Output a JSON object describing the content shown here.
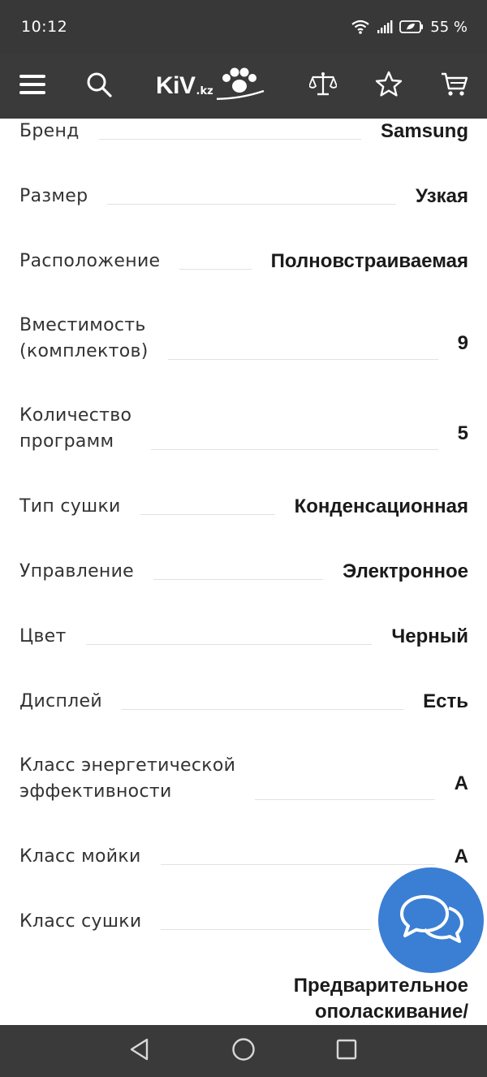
{
  "status_bar": {
    "time": "10:12",
    "battery_text": "55 %",
    "icons": [
      "wifi-icon",
      "signal-icon",
      "battery-saver-icon"
    ]
  },
  "header": {
    "logo_text": "KiV",
    "logo_suffix": ".kz",
    "icons": [
      "menu-icon",
      "search-icon",
      "compare-scale-icon",
      "favorites-star-icon",
      "cart-icon"
    ]
  },
  "specs": [
    {
      "label": "Бренд",
      "value": "Samsung"
    },
    {
      "label": "Размер",
      "value": "Узкая"
    },
    {
      "label": "Расположение",
      "value": "Полновстраиваемая"
    },
    {
      "label_lines": [
        "Вместимость",
        "(комплектов)"
      ],
      "value": "9"
    },
    {
      "label_lines": [
        "Количество",
        "программ"
      ],
      "value": "5"
    },
    {
      "label": "Тип сушки",
      "value": "Конденсационная"
    },
    {
      "label": "Управление",
      "value": "Электронное"
    },
    {
      "label": "Цвет",
      "value": "Черный"
    },
    {
      "label": "Дисплей",
      "value": "Есть"
    },
    {
      "label_lines": [
        "Класс энергетической",
        "эффективности"
      ],
      "value": "A"
    },
    {
      "label": "Класс мойки",
      "value": "A"
    },
    {
      "label": "Класс сушки",
      "value": ""
    },
    {
      "label": "",
      "value_lines": [
        "Предварительное",
        "ополаскивание/"
      ]
    }
  ],
  "chat_button": {
    "icon": "chat-bubbles-icon"
  },
  "nav_bar": {
    "icons": [
      "back-triangle-icon",
      "home-circle-icon",
      "recents-square-icon"
    ]
  }
}
